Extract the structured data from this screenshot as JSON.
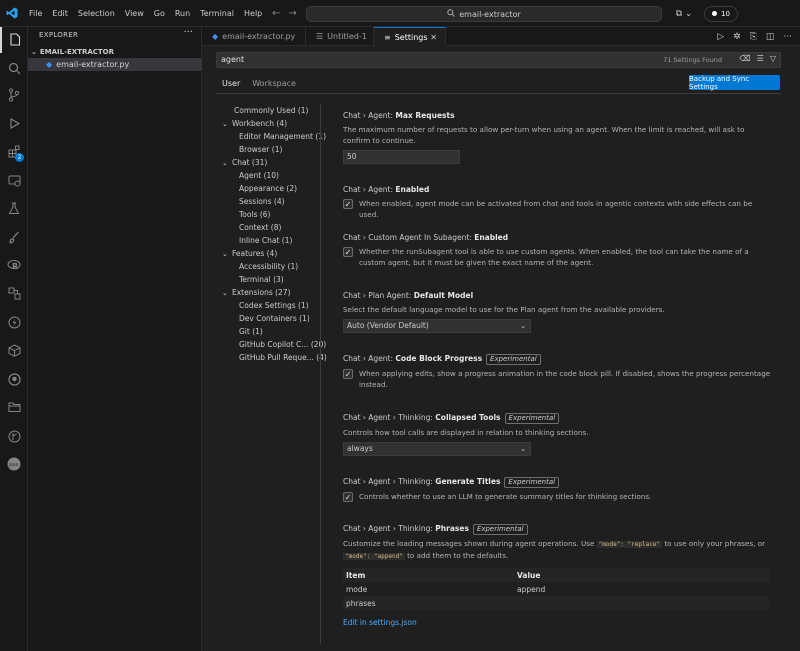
{
  "titlebar": {
    "menus": [
      "File",
      "Edit",
      "Selection",
      "View",
      "Go",
      "Run",
      "Terminal",
      "Help"
    ],
    "search_text": "email-extractor",
    "badge_count": "10"
  },
  "activity_bar": {
    "extensions_badge": "2",
    "icons": [
      "explorer-icon",
      "search-icon",
      "source-control-icon",
      "run-debug-icon",
      "extensions-icon",
      "remote-explorer-icon",
      "testing-icon",
      "paintbrush-icon",
      "r-icon",
      "json-outline-icon",
      "lightning-icon",
      "container-icon",
      "github-icon",
      "folder-icon",
      "git-graph-icon",
      "json-icon"
    ]
  },
  "sidebar": {
    "title": "EXPLORER",
    "folder": "EMAIL-EXTRACTOR",
    "files": [
      "email-extractor.py"
    ]
  },
  "tabs": [
    {
      "label": "email-extractor.py",
      "active": false
    },
    {
      "label": "Untitled-1",
      "active": false
    },
    {
      "label": "Settings",
      "active": true
    }
  ],
  "settings": {
    "search_value": "agent",
    "found_count": "71 Settings Found",
    "scopes": [
      "User",
      "Workspace"
    ],
    "sync_button": "Backup and Sync Settings",
    "toc": [
      {
        "label": "Commonly Used (1)",
        "level": 0,
        "chevron": ""
      },
      {
        "label": "Workbench (4)",
        "level": 0,
        "chevron": "v"
      },
      {
        "label": "Editor Management (1)",
        "level": 1,
        "chevron": ""
      },
      {
        "label": "Browser (1)",
        "level": 1,
        "chevron": ""
      },
      {
        "label": "Chat (31)",
        "level": 0,
        "chevron": "v"
      },
      {
        "label": "Agent (10)",
        "level": 1,
        "chevron": ""
      },
      {
        "label": "Appearance (2)",
        "level": 1,
        "chevron": ""
      },
      {
        "label": "Sessions (4)",
        "level": 1,
        "chevron": ""
      },
      {
        "label": "Tools (6)",
        "level": 1,
        "chevron": ""
      },
      {
        "label": "Context (8)",
        "level": 1,
        "chevron": ""
      },
      {
        "label": "Inline Chat (1)",
        "level": 1,
        "chevron": ""
      },
      {
        "label": "Features (4)",
        "level": 0,
        "chevron": "v"
      },
      {
        "label": "Accessibility (1)",
        "level": 1,
        "chevron": ""
      },
      {
        "label": "Terminal (3)",
        "level": 1,
        "chevron": ""
      },
      {
        "label": "Extensions (27)",
        "level": 0,
        "chevron": "v"
      },
      {
        "label": "Codex Settings (1)",
        "level": 1,
        "chevron": ""
      },
      {
        "label": "Dev Containers (1)",
        "level": 1,
        "chevron": ""
      },
      {
        "label": "Git (1)",
        "level": 1,
        "chevron": ""
      },
      {
        "label": "GitHub Copilot C... (20)",
        "level": 1,
        "chevron": ""
      },
      {
        "label": "GitHub Pull Reque... (4)",
        "level": 1,
        "chevron": ""
      }
    ],
    "items": {
      "max_requests": {
        "prefix": "Chat › Agent: ",
        "name": "Max Requests",
        "desc": "The maximum number of requests to allow per-turn when using an agent. When the limit is reached, will ask to confirm to continue.",
        "value": "50"
      },
      "agent_enabled": {
        "prefix": "Chat › Agent: ",
        "name": "Enabled",
        "desc": "When enabled, agent mode can be activated from chat and tools in agentic contexts with side effects can be used.",
        "checked": true
      },
      "custom_subagent": {
        "prefix": "Chat › Custom Agent In Subagent: ",
        "name": "Enabled",
        "desc": "Whether the runSubagent tool is able to use custom agents. When enabled, the tool can take the name of a custom agent, but it must be given the exact name of the agent.",
        "checked": true
      },
      "plan_model": {
        "prefix": "Chat › Plan Agent: ",
        "name": "Default Model",
        "desc": "Select the default language model to use for the Plan agent from the available providers.",
        "value": "Auto (Vendor Default)"
      },
      "code_block_progress": {
        "prefix": "Chat › Agent: ",
        "name": "Code Block Progress",
        "tag": "Experimental",
        "desc": "When applying edits, show a progress animation in the code block pill. If disabled, shows the progress percentage instead.",
        "checked": true
      },
      "collapsed_tools": {
        "prefix": "Chat › Agent › Thinking: ",
        "name": "Collapsed Tools",
        "tag": "Experimental",
        "desc": "Controls how tool calls are displayed in relation to thinking sections.",
        "value": "always"
      },
      "generate_titles": {
        "prefix": "Chat › Agent › Thinking: ",
        "name": "Generate Titles",
        "tag": "Experimental",
        "desc": "Controls whether to use an LLM to generate summary titles for thinking sections.",
        "checked": true
      },
      "phrases": {
        "prefix": "Chat › Agent › Thinking: ",
        "name": "Phrases",
        "tag": "Experimental",
        "desc_a": "Customize the loading messages shown during agent operations. Use ",
        "code_a": "\"mode\": \"replace\"",
        "desc_b": " to use only your phrases, or ",
        "code_b": "\"mode\": \"append\"",
        "desc_c": " to add them to the defaults.",
        "col_item": "Item",
        "col_value": "Value",
        "rows": [
          {
            "item": "mode",
            "value": "append"
          },
          {
            "item": "phrases",
            "value": ""
          }
        ],
        "edit_link": "Edit in settings.json"
      }
    }
  }
}
